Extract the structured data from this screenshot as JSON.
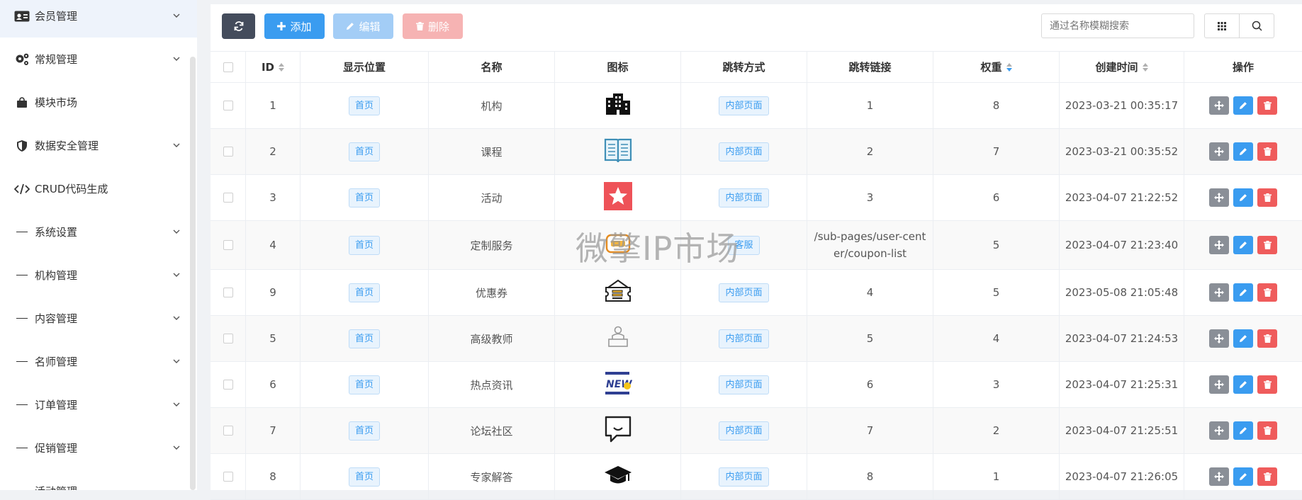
{
  "sidebar": {
    "items": [
      {
        "label": "会员管理",
        "icon": "member-card-icon",
        "expandable": true
      },
      {
        "label": "常规管理",
        "icon": "gears-icon",
        "expandable": true
      },
      {
        "label": "模块市场",
        "icon": "shopping-bag-icon",
        "expandable": false
      },
      {
        "label": "数据安全管理",
        "icon": "shield-icon",
        "expandable": true
      },
      {
        "label": "CRUD代码生成",
        "icon": "code-icon",
        "expandable": false
      },
      {
        "label": "系统设置",
        "icon": "dash-icon",
        "expandable": true
      },
      {
        "label": "机构管理",
        "icon": "dash-icon",
        "expandable": true
      },
      {
        "label": "内容管理",
        "icon": "dash-icon",
        "expandable": true
      },
      {
        "label": "名师管理",
        "icon": "dash-icon",
        "expandable": true
      },
      {
        "label": "订单管理",
        "icon": "dash-icon",
        "expandable": true
      },
      {
        "label": "促销管理",
        "icon": "dash-icon",
        "expandable": true
      },
      {
        "label": "活动管理",
        "icon": "dash-icon",
        "expandable": false
      }
    ]
  },
  "toolbar": {
    "refresh_icon": "refresh-icon",
    "add_label": "添加",
    "edit_label": "编辑",
    "delete_label": "删除",
    "search_placeholder": "通过名称模糊搜索"
  },
  "table": {
    "columns": [
      "ID",
      "显示位置",
      "名称",
      "图标",
      "跳转方式",
      "跳转链接",
      "权重",
      "创建时间",
      "操作"
    ],
    "rows": [
      {
        "id": "1",
        "position": "首页",
        "name": "机构",
        "icon": "building-icon",
        "jump_type": "内部页面",
        "link": "1",
        "weight": "8",
        "created": "2023-03-21 00:35:17"
      },
      {
        "id": "2",
        "position": "首页",
        "name": "课程",
        "icon": "open-book-icon",
        "jump_type": "内部页面",
        "link": "2",
        "weight": "7",
        "created": "2023-03-21 00:35:52"
      },
      {
        "id": "3",
        "position": "首页",
        "name": "活动",
        "icon": "star-badge-icon",
        "jump_type": "内部页面",
        "link": "3",
        "weight": "6",
        "created": "2023-04-07 21:22:52"
      },
      {
        "id": "4",
        "position": "首页",
        "name": "定制服务",
        "icon": "custom-service-icon",
        "jump_type": "客服",
        "link_line1": "/sub-pages/user-cent",
        "link_line2": "er/coupon-list",
        "weight": "5",
        "created": "2023-04-07 21:23:40"
      },
      {
        "id": "9",
        "position": "首页",
        "name": "优惠券",
        "icon": "coupon-icon",
        "jump_type": "内部页面",
        "link": "4",
        "weight": "5",
        "created": "2023-05-08 21:05:48"
      },
      {
        "id": "5",
        "position": "首页",
        "name": "高级教师",
        "icon": "teacher-icon",
        "jump_type": "内部页面",
        "link": "5",
        "weight": "4",
        "created": "2023-04-07 21:24:53"
      },
      {
        "id": "6",
        "position": "首页",
        "name": "热点资讯",
        "icon": "news-icon",
        "jump_type": "内部页面",
        "link": "6",
        "weight": "3",
        "created": "2023-04-07 21:25:31"
      },
      {
        "id": "7",
        "position": "首页",
        "name": "论坛社区",
        "icon": "chat-icon",
        "jump_type": "内部页面",
        "link": "7",
        "weight": "2",
        "created": "2023-04-07 21:25:51"
      },
      {
        "id": "8",
        "position": "首页",
        "name": "专家解答",
        "icon": "graduation-cap-icon",
        "jump_type": "内部页面",
        "link": "8",
        "weight": "1",
        "created": "2023-04-07 21:26:05"
      }
    ]
  },
  "watermark": "微擎IP市场",
  "colors": {
    "primary": "#3a9cf0",
    "danger": "#ef5c5c",
    "dark": "#444c5c",
    "tag_bg": "#e8f3fd"
  }
}
